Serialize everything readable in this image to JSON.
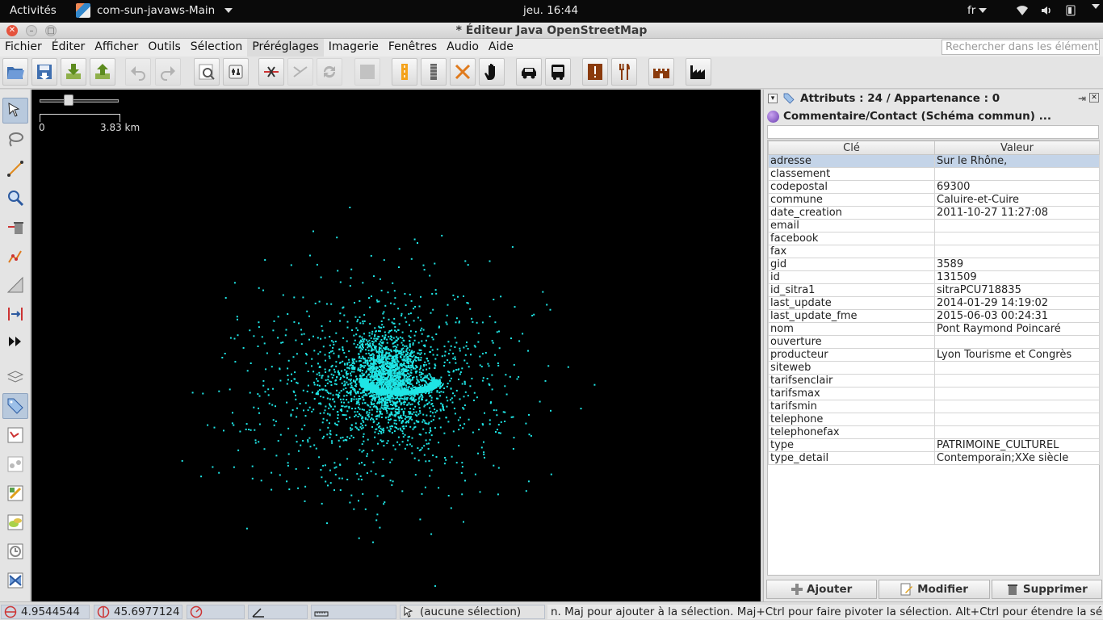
{
  "topbar": {
    "activities": "Activités",
    "app_name": "com-sun-javaws-Main",
    "clock": "jeu. 16:44",
    "lang": "fr"
  },
  "window": {
    "title": "* Éditeur Java OpenStreetMap"
  },
  "menu": {
    "items": [
      "Fichier",
      "Éditer",
      "Afficher",
      "Outils",
      "Sélection",
      "Préréglages",
      "Imagerie",
      "Fenêtres",
      "Audio",
      "Aide"
    ],
    "selected": "Préréglages",
    "search_placeholder": "Rechercher dans les éléments"
  },
  "toolbar": {
    "icons": [
      "open-file-icon",
      "save-icon",
      "download-icon",
      "upload-icon",
      "undo-icon",
      "redo-icon",
      "zoom-selection-icon",
      "preferences-icon",
      "split-way-icon",
      "combine-way-icon",
      "reverse-way-icon",
      "wms-icon",
      "bus-stop-icon",
      "railway-icon",
      "barrier-icon",
      "hand-icon",
      "car-icon",
      "bus-icon",
      "attention-icon",
      "restaurant-icon",
      "castle-icon",
      "industrial-icon"
    ]
  },
  "map": {
    "scale_zero": "0",
    "scale_max": "3.83 km",
    "zoom_level": 0.35,
    "point_color": "#1fe5e5"
  },
  "panel": {
    "header": "Attributs : 24 / Appartenance : 0",
    "preset": "Commentaire/Contact (Schéma commun) ...",
    "col_key": "Clé",
    "col_value": "Valeur",
    "rows": [
      {
        "k": "adresse",
        "v": "Sur le Rhône,"
      },
      {
        "k": "classement",
        "v": ""
      },
      {
        "k": "codepostal",
        "v": "69300"
      },
      {
        "k": "commune",
        "v": "Caluire-et-Cuire"
      },
      {
        "k": "date_creation",
        "v": "2011-10-27 11:27:08"
      },
      {
        "k": "email",
        "v": ""
      },
      {
        "k": "facebook",
        "v": ""
      },
      {
        "k": "fax",
        "v": ""
      },
      {
        "k": "gid",
        "v": "3589"
      },
      {
        "k": "id",
        "v": "131509"
      },
      {
        "k": "id_sitra1",
        "v": "sitraPCU718835"
      },
      {
        "k": "last_update",
        "v": "2014-01-29 14:19:02"
      },
      {
        "k": "last_update_fme",
        "v": "2015-06-03 00:24:31"
      },
      {
        "k": "nom",
        "v": "Pont Raymond Poincaré"
      },
      {
        "k": "ouverture",
        "v": ""
      },
      {
        "k": "producteur",
        "v": "Lyon Tourisme et Congrès"
      },
      {
        "k": "siteweb",
        "v": ""
      },
      {
        "k": "tarifsenclair",
        "v": ""
      },
      {
        "k": "tarifsmax",
        "v": ""
      },
      {
        "k": "tarifsmin",
        "v": ""
      },
      {
        "k": "telephone",
        "v": ""
      },
      {
        "k": "telephonefax",
        "v": ""
      },
      {
        "k": "type",
        "v": "PATRIMOINE_CULTUREL"
      },
      {
        "k": "type_detail",
        "v": "Contemporain;XXe siècle"
      }
    ],
    "btn_add": "Ajouter",
    "btn_edit": "Modifier",
    "btn_delete": "Supprimer"
  },
  "status": {
    "lon": "4.9544544",
    "lat": "45.6977124",
    "selection": "(aucune sélection)",
    "message": "n. Maj pour ajouter à la sélection. Maj+Ctrl pour faire pivoter la sélection. Alt+Ctrl pour étendre la sélection."
  }
}
